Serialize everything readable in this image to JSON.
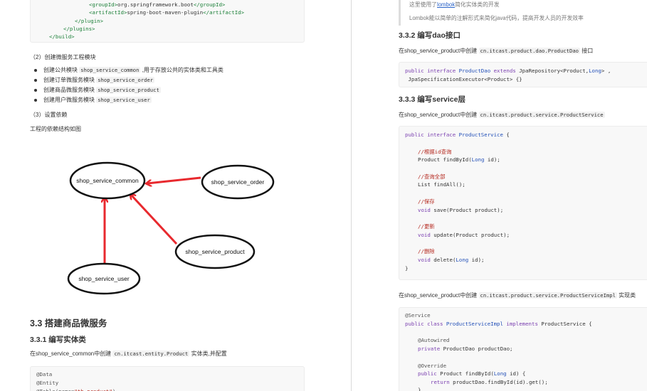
{
  "left": {
    "pom_lines": [
      {
        "open": "<groupId>",
        "value": "org.springframework.boot",
        "close": "</groupId>"
      },
      {
        "open": "<artifactId>",
        "value": "spring-boot-maven-plugin",
        "close": "</artifactId>"
      },
      {
        "open": "</plugin>",
        "value": "",
        "close": ""
      },
      {
        "open": "</plugins>",
        "value": "",
        "close": ""
      },
      {
        "open": "</build>",
        "value": "",
        "close": ""
      }
    ],
    "step2": "（2）创建微服务工程模块",
    "modules": [
      {
        "pre": "创建公共模块 ",
        "code": "shop_service_common",
        "post": " ,用于存放公共的实体类和工具类"
      },
      {
        "pre": "创建订单微服务模块 ",
        "code": "shop_service_order",
        "post": ""
      },
      {
        "pre": "创建商品微服务模块 ",
        "code": "shop_service_product",
        "post": ""
      },
      {
        "pre": "创建用户微服务模块 ",
        "code": "shop_service_user",
        "post": ""
      }
    ],
    "step3": "（3）设置依赖",
    "dep_caption": "工程的依赖结构如图",
    "diagram_nodes": {
      "common": "shop_service_common",
      "order": "shop_service_order",
      "product": "shop_service_product",
      "user": "shop_service_user"
    },
    "h_33": "3.3 搭建商品微服务",
    "h_331": "3.3.1 编写实体类",
    "entity_text_pre": "在shop_service_common中创建 ",
    "entity_text_code": "cn.itcast.entity.Product",
    "entity_text_post": " 实体类,并配置",
    "entity_lines": [
      "@Data",
      "@Entity",
      "@Table(name=\"tb_product\")"
    ]
  },
  "right": {
    "quote_line1_pre": "这里使用了",
    "quote_link": "lombok",
    "quote_line1_post": "简化实体类的开发",
    "quote_line2": "Lombok能以简单的注解形式来简化java代码，提高开发人员的开发效率",
    "h_332": "3.3.2 编写dao接口",
    "dao_text_pre": "在shop_service_product中创建 ",
    "dao_text_code": "cn.itcast.product.dao.ProductDao",
    "dao_text_post": " 接口",
    "h_333": "3.3.3 编写service层",
    "svc_text_pre": "在shop_service_product中创建 ",
    "svc_text_code": "cn.itcast.product.service.ProductService",
    "impl_text_pre": "在shop_service_product中创建 ",
    "impl_text_code": "cn.itcast.product.service.ProductServiceImpl",
    "impl_text_post": " 实现类",
    "comments": {
      "find": "//根据id查询",
      "all": "//查询全部",
      "save": "//保存",
      "update": "//更新",
      "delete": "//删除"
    }
  }
}
